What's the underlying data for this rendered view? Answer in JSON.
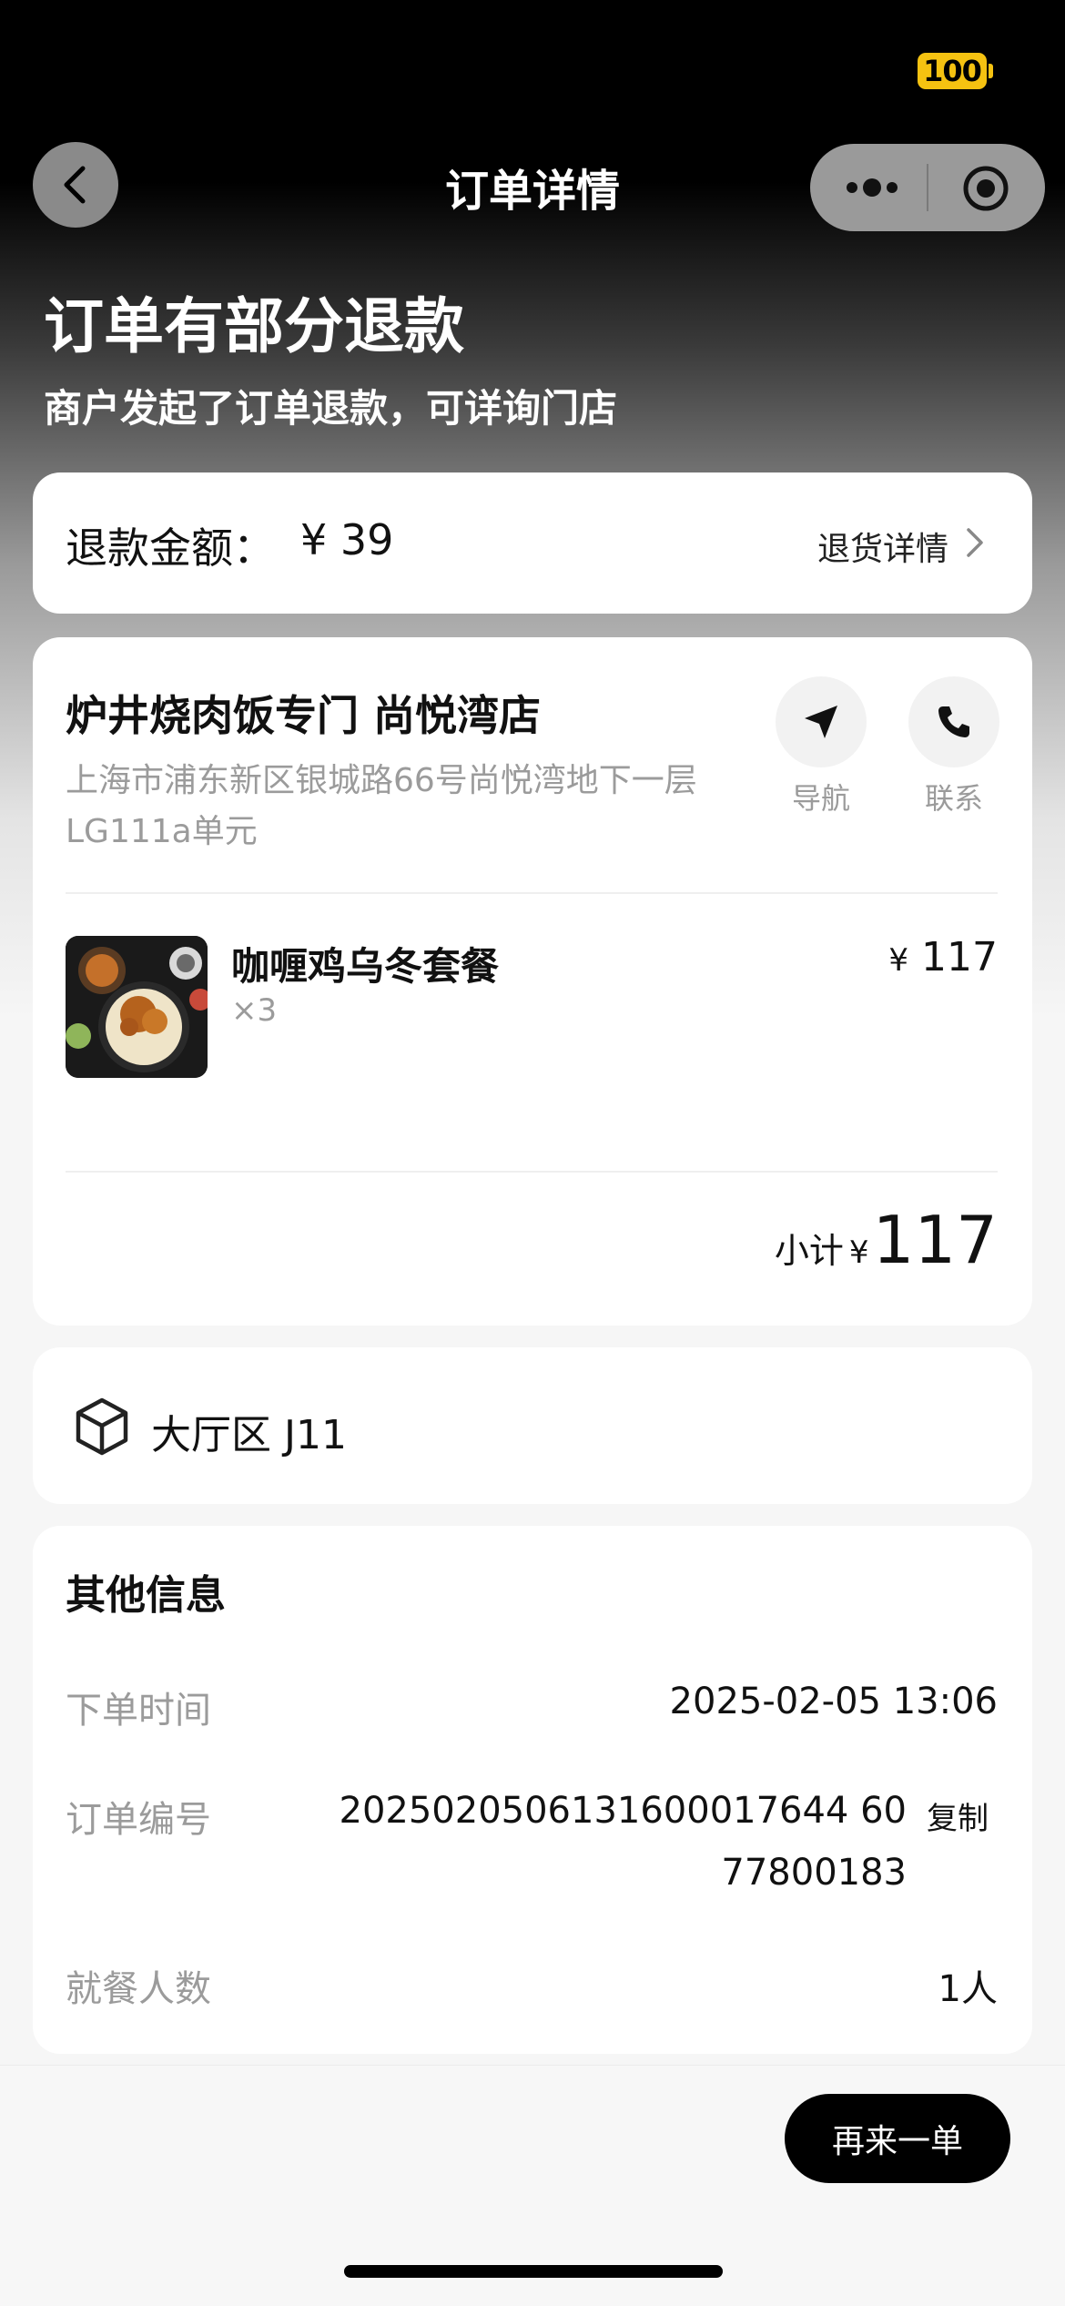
{
  "status_bar": {
    "battery": "100"
  },
  "nav": {
    "title": "订单详情",
    "back_icon": "chevron-left-icon",
    "more_icon": "more-dots-icon",
    "close_icon": "target-icon"
  },
  "order_status": {
    "title": "订单有部分退款",
    "subtitle": "商户发起了订单退款，可详询门店"
  },
  "refund": {
    "label": "退款金额：",
    "amount": "¥ 39",
    "detail_link": "退货详情"
  },
  "store": {
    "name": "炉井烧肉饭专门 尚悦湾店",
    "address": "上海市浦东新区银城路66号尚悦湾地下一层LG111a单元",
    "navigate_label": "导航",
    "contact_label": "联系"
  },
  "items": [
    {
      "name": "咖喱鸡乌冬套餐",
      "qty": "×3",
      "currency": "¥",
      "price": "117"
    }
  ],
  "subtotal": {
    "label": "小计",
    "currency": "¥",
    "value": "117"
  },
  "table": {
    "text": "大厅区 J11",
    "icon": "box-icon"
  },
  "other_info": {
    "title": "其他信息",
    "order_time_label": "下单时间",
    "order_time": "2025-02-05 13:06",
    "order_no_label": "订单编号",
    "order_no_line1": "2025020506131600017644 60",
    "order_no_line2": "77800183",
    "copy_label": "复制",
    "diners_label": "就餐人数",
    "diners": "1人"
  },
  "actions": {
    "reorder": "再来一单"
  },
  "colors": {
    "battery": "#f5c211",
    "primary_button": "#000000",
    "muted_text": "#9b9b9b"
  }
}
